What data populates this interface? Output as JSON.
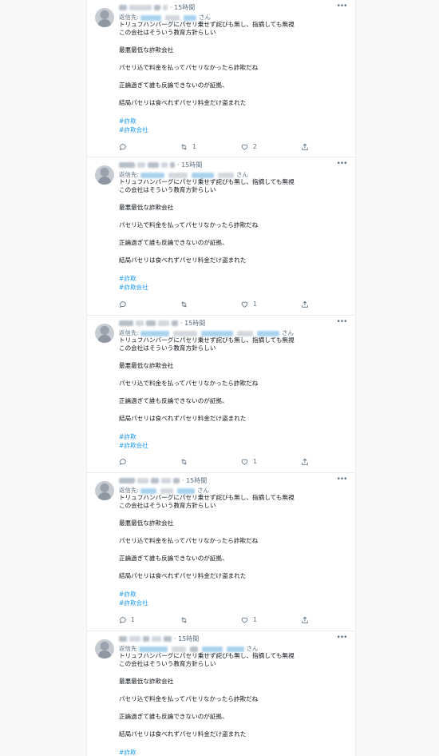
{
  "timeline": {
    "tweets": [
      {
        "time": "15時間",
        "reply_prefix": "返信先:",
        "reply_suffix": "さん",
        "lines": [
          "トリュフハンバーグにパセリ乗せず詫びも無し、指摘しても無視",
          "この会社はそういう教育方針らしい",
          "最悪最低な詐欺会社",
          "パセリ込で料金を払ってパセリなかったら詐欺だね",
          "正論過ぎて誰も反論できないのが証拠、",
          "結局パセリは食べれずパセリ料金だけ盗まれた"
        ],
        "hashtags": [
          "#詐欺",
          "#詐欺会社"
        ],
        "reply_count": "",
        "retweet_count": "1",
        "like_count": "2"
      },
      {
        "time": "15時間",
        "reply_prefix": "返信先:",
        "reply_suffix": "さん",
        "lines": [
          "トリュフハンバーグにパセリ乗せず詫びも無し、指摘しても無視",
          "この会社はそういう教育方針らしい",
          "最悪最低な詐欺会社",
          "パセリ込で料金を払ってパセリなかったら詐欺だね",
          "正論過ぎて誰も反論できないのが証拠、",
          "結局パセリは食べれずパセリ料金だけ盗まれた"
        ],
        "hashtags": [
          "#詐欺",
          "#詐欺会社"
        ],
        "reply_count": "",
        "retweet_count": "",
        "like_count": "1"
      },
      {
        "time": "15時間",
        "reply_prefix": "返信先:",
        "reply_suffix": "さん",
        "lines": [
          "トリュフハンバーグにパセリ乗せず詫びも無し、指摘しても無視",
          "この会社はそういう教育方針らしい",
          "最悪最低な詐欺会社",
          "パセリ込で料金を払ってパセリなかったら詐欺だね",
          "正論過ぎて誰も反論できないのが証拠、",
          "結局パセリは食べれずパセリ料金だけ盗まれた"
        ],
        "hashtags": [
          "#詐欺",
          "#詐欺会社"
        ],
        "reply_count": "",
        "retweet_count": "",
        "like_count": "1"
      },
      {
        "time": "15時間",
        "reply_prefix": "返信先:",
        "reply_suffix": "さん",
        "lines": [
          "トリュフハンバーグにパセリ乗せず詫びも無し、指摘しても無視",
          "この会社はそういう教育方針らしい",
          "最悪最低な詐欺会社",
          "パセリ込で料金を払ってパセリなかったら詐欺だね",
          "正論過ぎて誰も反論できないのが証拠、",
          "結局パセリは食べれずパセリ料金だけ盗まれた"
        ],
        "hashtags": [
          "#詐欺",
          "#詐欺会社"
        ],
        "reply_count": "1",
        "retweet_count": "",
        "like_count": "1"
      },
      {
        "time": "15時間",
        "reply_prefix": "返信先",
        "reply_suffix": "さん",
        "lines": [
          "トリュフハンバーグにパセリ乗せず詫びも無し、指摘しても無視",
          "この会社はそういう教育方針らしい",
          "最悪最低な詐欺会社",
          "パセリ込で料金を払ってパセリなかったら詐欺だね",
          "正論過ぎて誰も反論できないのが証拠、",
          "結局パセリは食べれずパセリ料金だけ盗まれた"
        ],
        "hashtags": [
          "#詐欺"
        ],
        "reply_count": "",
        "retweet_count": "",
        "like_count": ""
      }
    ]
  },
  "icons": {
    "more": "more-icon",
    "reply": "reply-icon",
    "retweet": "retweet-icon",
    "like": "like-icon",
    "share": "share-icon"
  },
  "colors": {
    "text": "#0f1419",
    "secondary": "#5b7083",
    "link": "#1d9bf0",
    "border": "#e6ecf0"
  }
}
